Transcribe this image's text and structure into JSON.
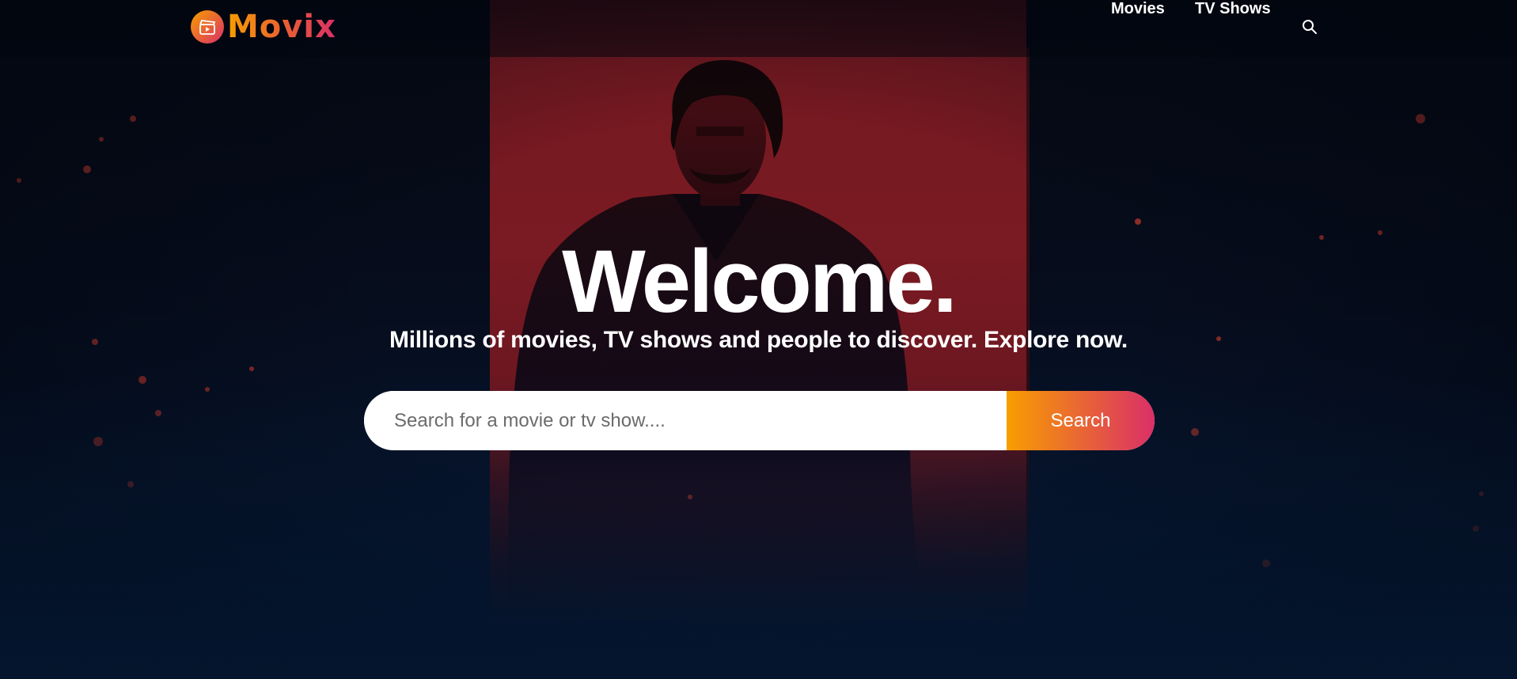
{
  "header": {
    "logo_text": "Movix",
    "nav": [
      {
        "label": "Movies"
      },
      {
        "label": "TV Shows"
      }
    ],
    "search_icon": "search-icon"
  },
  "hero": {
    "title": "Welcome.",
    "subtitle": "Millions of movies, TV shows and people to discover. Explore now.",
    "search": {
      "placeholder": "Search for a movie or tv show....",
      "value": "",
      "button_label": "Search"
    }
  },
  "colors": {
    "gradient_start": "#f89e00",
    "gradient_end": "#da2f68",
    "background": "#04152d",
    "panel_red": "#7a1a22"
  }
}
